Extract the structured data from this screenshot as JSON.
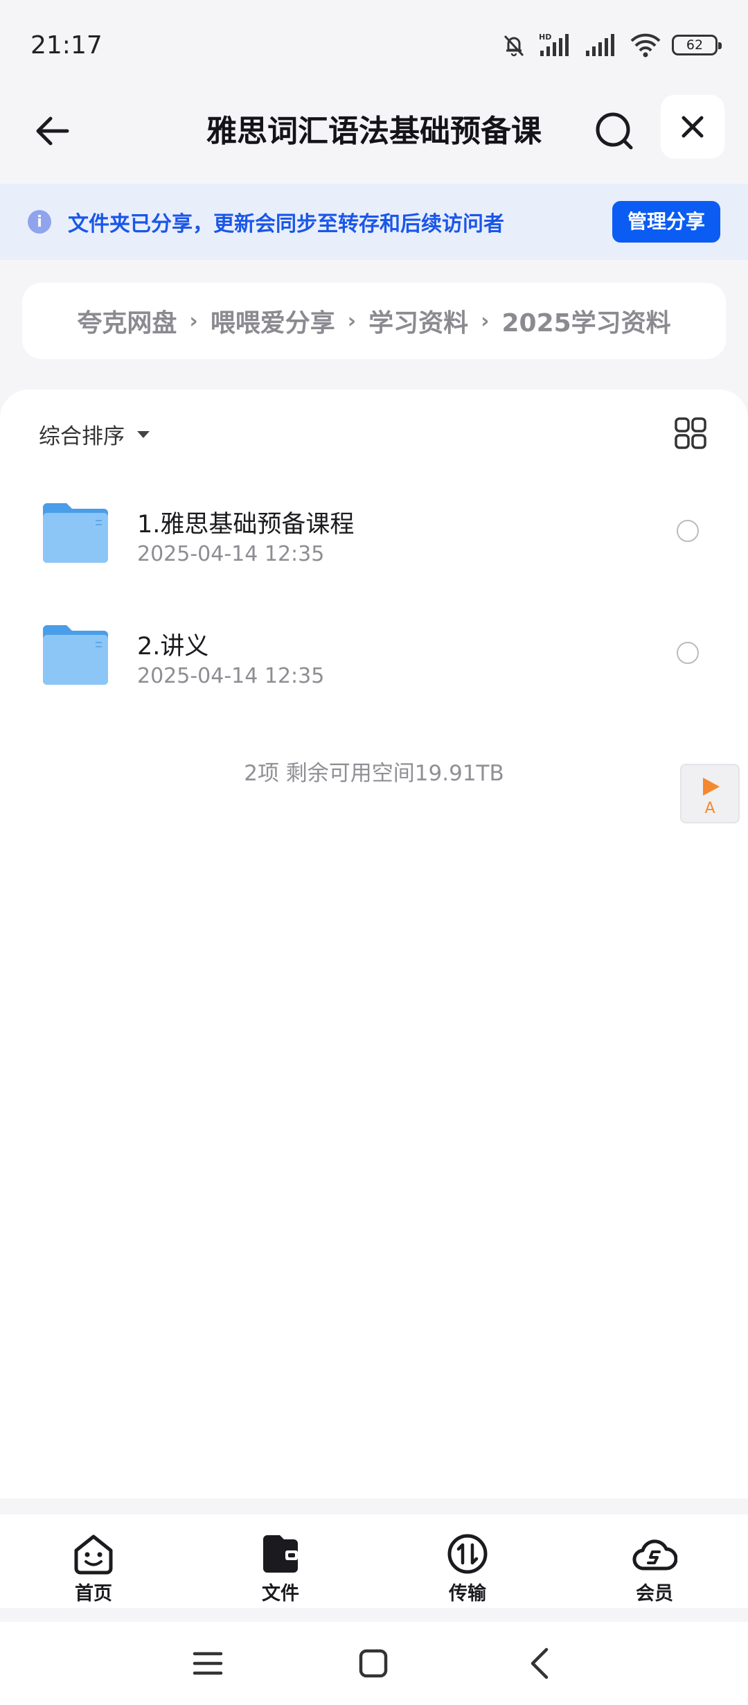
{
  "status_bar": {
    "time": "21:17",
    "battery": "62",
    "hd_label": "HD"
  },
  "header": {
    "title": "雅思词汇语法基础预备课"
  },
  "share_banner": {
    "text": "文件夹已分享，更新会同步至转存和后续访问者",
    "manage_label": "管理分享",
    "info_glyph": "i"
  },
  "breadcrumb": {
    "items": [
      "夸克网盘",
      "喂喂爱分享",
      "学习资料",
      "2025学习资料"
    ],
    "separator": "›"
  },
  "sort": {
    "label": "综合排序"
  },
  "files": [
    {
      "name": "1.雅思基础预备课程",
      "date": "2025-04-14 12:35",
      "type": "folder"
    },
    {
      "name": "2.讲义",
      "date": "2025-04-14 12:35",
      "type": "folder"
    }
  ],
  "footer_info": "2项 剩余可用空间19.91TB",
  "float_player": {
    "label": "A"
  },
  "bottom_nav": [
    {
      "label": "首页",
      "icon": "home-face-icon"
    },
    {
      "label": "文件",
      "icon": "file-wallet-icon",
      "active": true
    },
    {
      "label": "传输",
      "icon": "transfer-icon"
    },
    {
      "label": "会员",
      "icon": "member-cloud-icon"
    }
  ],
  "colors": {
    "accent": "#0b5cf3",
    "banner_bg": "#e9eefb",
    "banner_text": "#1a57e8",
    "folder": "#5aaaf0",
    "float_accent": "#f5892f"
  }
}
